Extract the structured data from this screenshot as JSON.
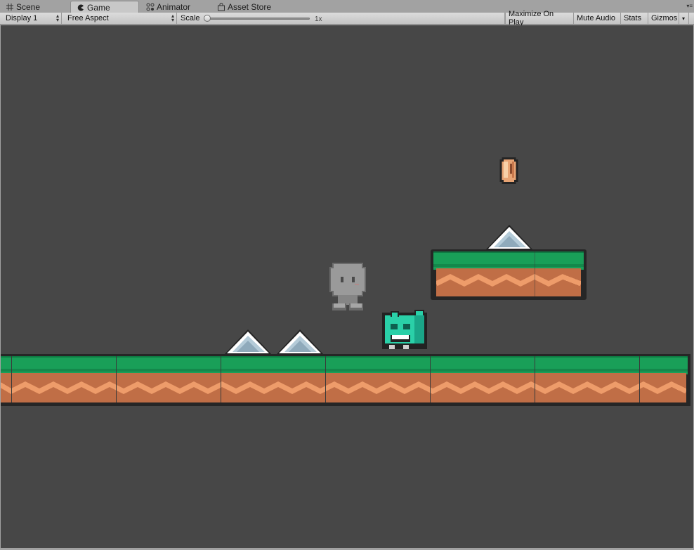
{
  "tabs": [
    {
      "label": "Scene",
      "icon": "grid-icon"
    },
    {
      "label": "Game",
      "icon": "pacman-icon",
      "active": true
    },
    {
      "label": "Animator",
      "icon": "animator-icon"
    },
    {
      "label": "Asset Store",
      "icon": "store-bag-icon"
    }
  ],
  "toolbar": {
    "display": "Display 1",
    "aspect": "Free Aspect",
    "scale_label": "Scale",
    "scale_value": "1x",
    "maximize": "Maximize On Play",
    "mute": "Mute Audio",
    "stats": "Stats",
    "gizmos": "Gizmos"
  },
  "colors": {
    "background": "#474747",
    "grass": "#199f58",
    "dirt": "#c06e46",
    "player": "#2ad0a8",
    "enemy_ghost": "#9a9a9a"
  }
}
